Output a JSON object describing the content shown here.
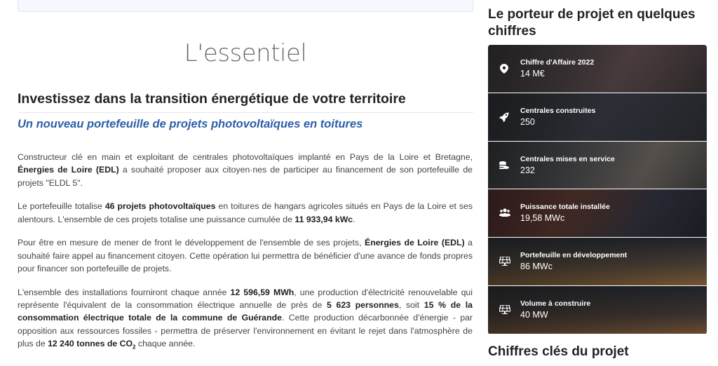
{
  "main": {
    "heading": "L'essentiel",
    "subtitle": "Investissez dans la transition énergétique de votre territoire",
    "tagline": "Un nouveau portefeuille de projets photovoltaïques en toitures",
    "p1": {
      "a": "Constructeur clé en main et exploitant de centrales photovoltaïques implanté en Pays de la Loire et Bretagne, ",
      "b": "Énergies de Loire (EDL)",
      "c": " a souhaité proposer aux citoyen·nes de participer au financement de son portefeuille de projets \"ELDL 5\"."
    },
    "p2": {
      "a": "Le portefeuille totalise ",
      "b": "46 projets photovoltaïques",
      "c": " en toitures de hangars agricoles situés en Pays de la Loire et ses alentours. L'ensemble de ces projets totalise une puissance cumulée de ",
      "d": "11 933,94 kWc",
      "e": "."
    },
    "p3": {
      "a": "Pour être en mesure de mener de front le développement de l'ensemble de ses projets, ",
      "b": "Énergies de Loire (EDL)",
      "c": " a souhaité faire appel au financement citoyen. Cette opération lui permettra de bénéficier d'une avance de fonds propres pour financer son portefeuille de projets."
    },
    "p4": {
      "a": "L'ensemble des installations fourniront chaque année ",
      "b": "12 596,59 MWh",
      "c": ", une production d'électricité renouvelable qui représente l'équivalent de la consommation électrique annuelle de près de ",
      "d": "5 623 personnes",
      "e": ", soit ",
      "f": "15 % de la consommation électrique totale de la commune de Guérande",
      "g": ". Cette production décarbonnée d'énergie - par opposition aux ressources fossiles - permettra de préserver l'environnement en évitant le rejet dans l'atmosphère de plus de ",
      "h": "12 240 tonnes de CO",
      "h_sub": "2",
      "i": " chaque année."
    }
  },
  "sidebar": {
    "title": "Le porteur de projet en quelques chiffres",
    "stats": [
      {
        "icon": "map-pin-icon",
        "label": "Chiffre d'Affaire 2022",
        "value": "14 M€"
      },
      {
        "icon": "rocket-icon",
        "label": "Centrales construites",
        "value": "250"
      },
      {
        "icon": "coins-icon",
        "label": "Centrales mises en service",
        "value": "232"
      },
      {
        "icon": "users-icon",
        "label": "Puissance totale installée",
        "value": "19,58 MWc"
      },
      {
        "icon": "solar-panel-icon",
        "label": "Portefeuille en développement",
        "value": "86 MWc"
      },
      {
        "icon": "solar-panel-icon",
        "label": "Volume à construire",
        "value": "40 MW"
      }
    ],
    "section2_title": "Chiffres clés du projet"
  }
}
